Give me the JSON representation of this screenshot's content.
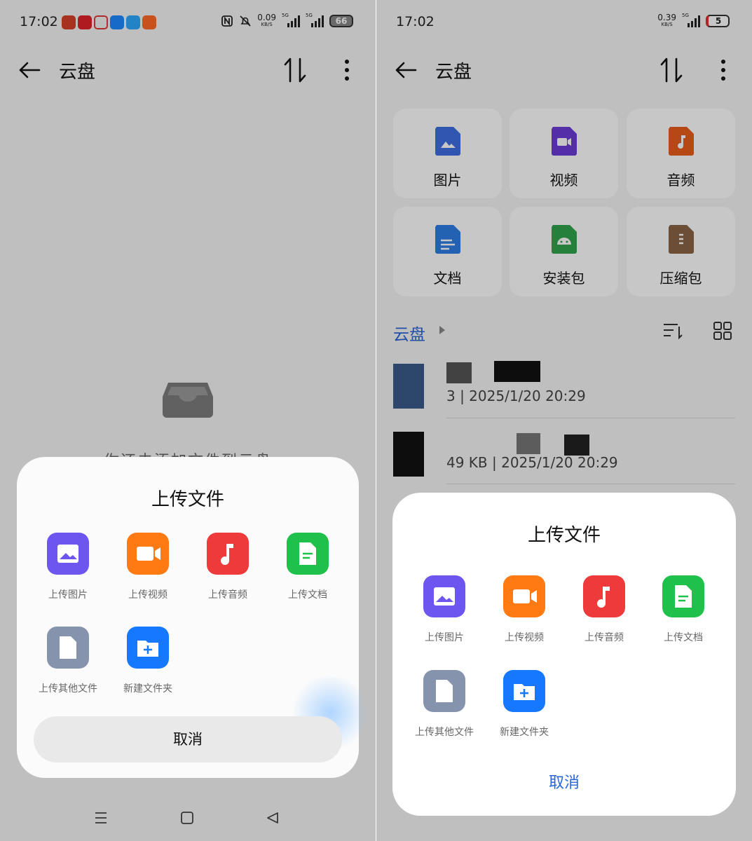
{
  "status_left": {
    "time": "17:02",
    "speed_value": "0.09",
    "speed_unit": "KB/S",
    "network": "5G",
    "battery": "66"
  },
  "status_right": {
    "time": "17:02",
    "speed_value": "0.39",
    "speed_unit": "KB/S",
    "network": "5G",
    "battery": "5"
  },
  "header": {
    "title": "云盘"
  },
  "empty_state": {
    "text": "你还未添加文件到云盘"
  },
  "upload_sheet": {
    "title": "上传文件",
    "items": [
      {
        "label": "上传图片",
        "color": "#6d55f0",
        "icon": "image-upload-icon"
      },
      {
        "label": "上传视频",
        "color": "#ff7a12",
        "icon": "video-upload-icon"
      },
      {
        "label": "上传音频",
        "color": "#ee3a3a",
        "icon": "audio-upload-icon"
      },
      {
        "label": "上传文档",
        "color": "#1fc14a",
        "icon": "document-upload-icon"
      },
      {
        "label": "上传其他文件",
        "color": "#8593ad",
        "icon": "file-upload-icon"
      },
      {
        "label": "新建文件夹",
        "color": "#1677ff",
        "icon": "new-folder-icon"
      }
    ],
    "cancel": "取消"
  },
  "categories": [
    {
      "label": "图片",
      "color": "#3f6fe3"
    },
    {
      "label": "视频",
      "color": "#6c3bd9"
    },
    {
      "label": "音频",
      "color": "#e85d1c"
    },
    {
      "label": "文档",
      "color": "#2e7ee6"
    },
    {
      "label": "安装包",
      "color": "#2fa44c"
    },
    {
      "label": "压缩包",
      "color": "#8a6445"
    }
  ],
  "breadcrumb": {
    "root": "云盘"
  },
  "files": [
    {
      "meta": "3 | 2025/1/20 20:29"
    },
    {
      "meta": "49 KB | 2025/1/20 20:29"
    }
  ]
}
